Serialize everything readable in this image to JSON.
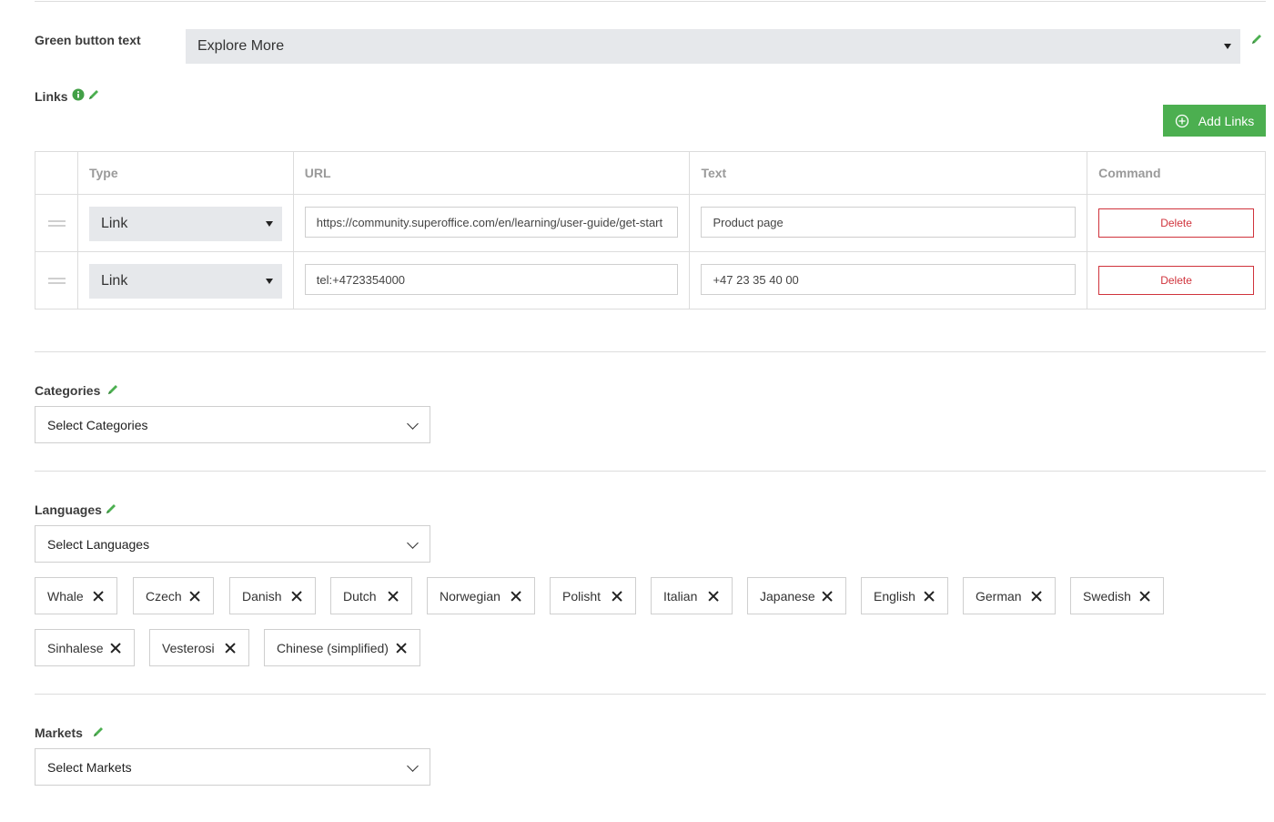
{
  "green_button_text": {
    "label": "Green button text",
    "value": "Explore More"
  },
  "links": {
    "label": "Links",
    "add_button": "Add Links",
    "columns": [
      "Type",
      "URL",
      "Text",
      "Command"
    ],
    "rows": [
      {
        "type": "Link",
        "url": "https://community.superoffice.com/en/learning/user-guide/get-start",
        "text": "Product page",
        "command": "Delete"
      },
      {
        "type": "Link",
        "url": "tel:+4723354000",
        "text": "+47 23 35 40 00",
        "command": "Delete"
      }
    ]
  },
  "categories": {
    "label": "Categories",
    "placeholder": "Select Categories"
  },
  "languages": {
    "label": "Languages",
    "placeholder": "Select Languages",
    "tags": [
      "Whale",
      "Czech",
      "Danish",
      "Dutch",
      "Norwegian",
      "Polisht",
      "Italian",
      "Japanese",
      "English",
      "German",
      "Swedish",
      "Sinhalese",
      "Vesterosi",
      "Chinese (simplified)"
    ]
  },
  "markets": {
    "label": "Markets",
    "placeholder": "Select Markets"
  },
  "colors": {
    "accent_green": "#4caf50",
    "delete_red": "#d0333c",
    "info_green": "#43a047"
  },
  "icons": {
    "edit": "pencil-icon",
    "info": "info-icon",
    "add": "plus-circle-icon",
    "remove": "close-icon",
    "dropdown": "chevron-down-icon",
    "drag": "drag-handle-icon"
  }
}
